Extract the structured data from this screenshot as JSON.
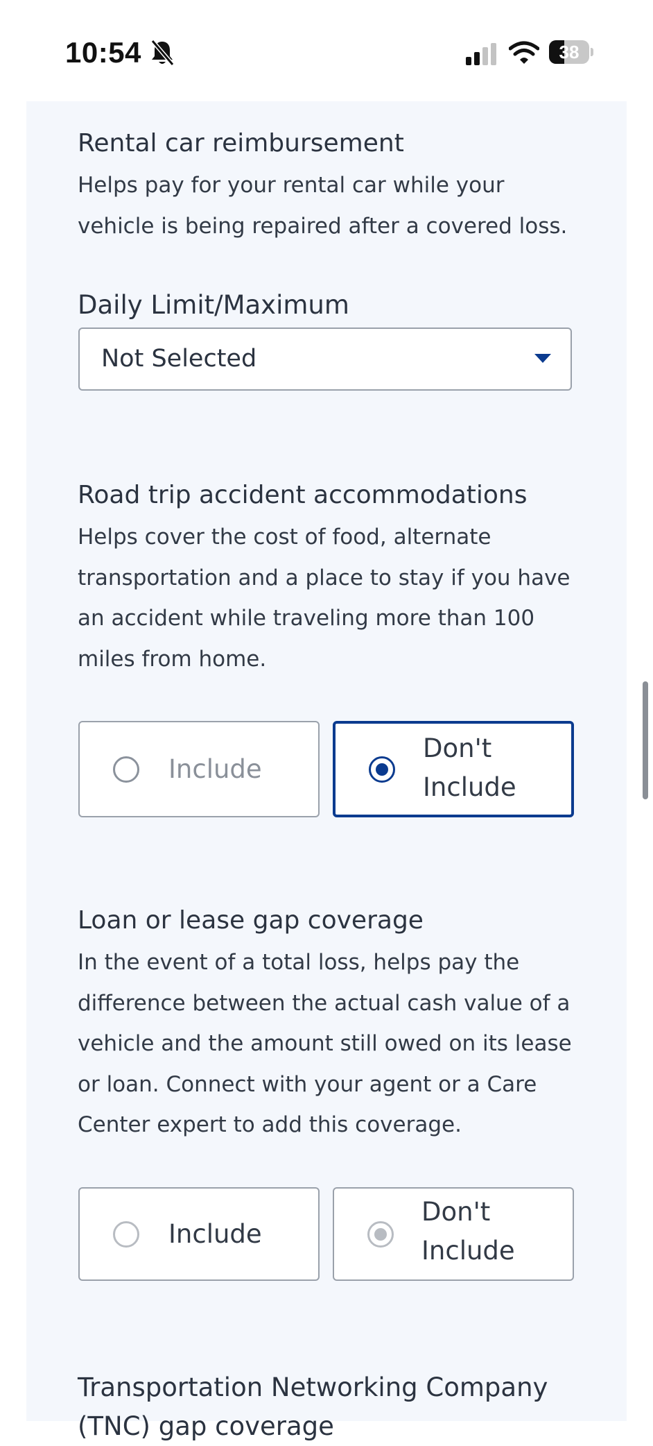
{
  "status_bar": {
    "time": "10:54",
    "battery_percent": "38",
    "battery_level": 0.38,
    "icons": [
      "bell-slash-icon",
      "cellular-signal-icon",
      "wifi-icon",
      "battery-icon"
    ]
  },
  "colors": {
    "accent": "#0b3b8f",
    "panel_background": "#f4f7fc",
    "border": "#9aa1ab",
    "text": "#2b3340",
    "muted_text": "#8a9099"
  },
  "rental": {
    "title": "Rental car reimbursement",
    "desc_lines": [
      "Helps pay for your rental car while your",
      "vehicle is being repaired after a covered loss."
    ],
    "field_label": "Daily Limit/Maximum",
    "select_value": "Not Selected"
  },
  "road_trip": {
    "title": "Road trip accident accommodations",
    "desc_lines": [
      "Helps cover the cost of food, alternate",
      "transportation and a place to stay if you have",
      "an accident while traveling more than 100",
      "miles from home."
    ],
    "include_label": "Include",
    "dont_include_label_1": "Don't",
    "dont_include_label_2": "Include",
    "selected": "dont_include"
  },
  "loan_gap": {
    "title": "Loan or lease gap coverage",
    "desc_lines": [
      "In the event of a total loss, helps pay the",
      "difference between the actual cash value of a",
      "vehicle and the amount still owed on its lease",
      "or loan. Connect with your agent or a Care",
      "Center expert to add this coverage."
    ],
    "include_label": "Include",
    "dont_include_label_1": "Don't",
    "dont_include_label_2": "Include",
    "selected": "dont_include",
    "disabled": true
  },
  "tnc": {
    "title_line_1": "Transportation Networking Company",
    "title_line_2": "(TNC) gap coverage"
  }
}
